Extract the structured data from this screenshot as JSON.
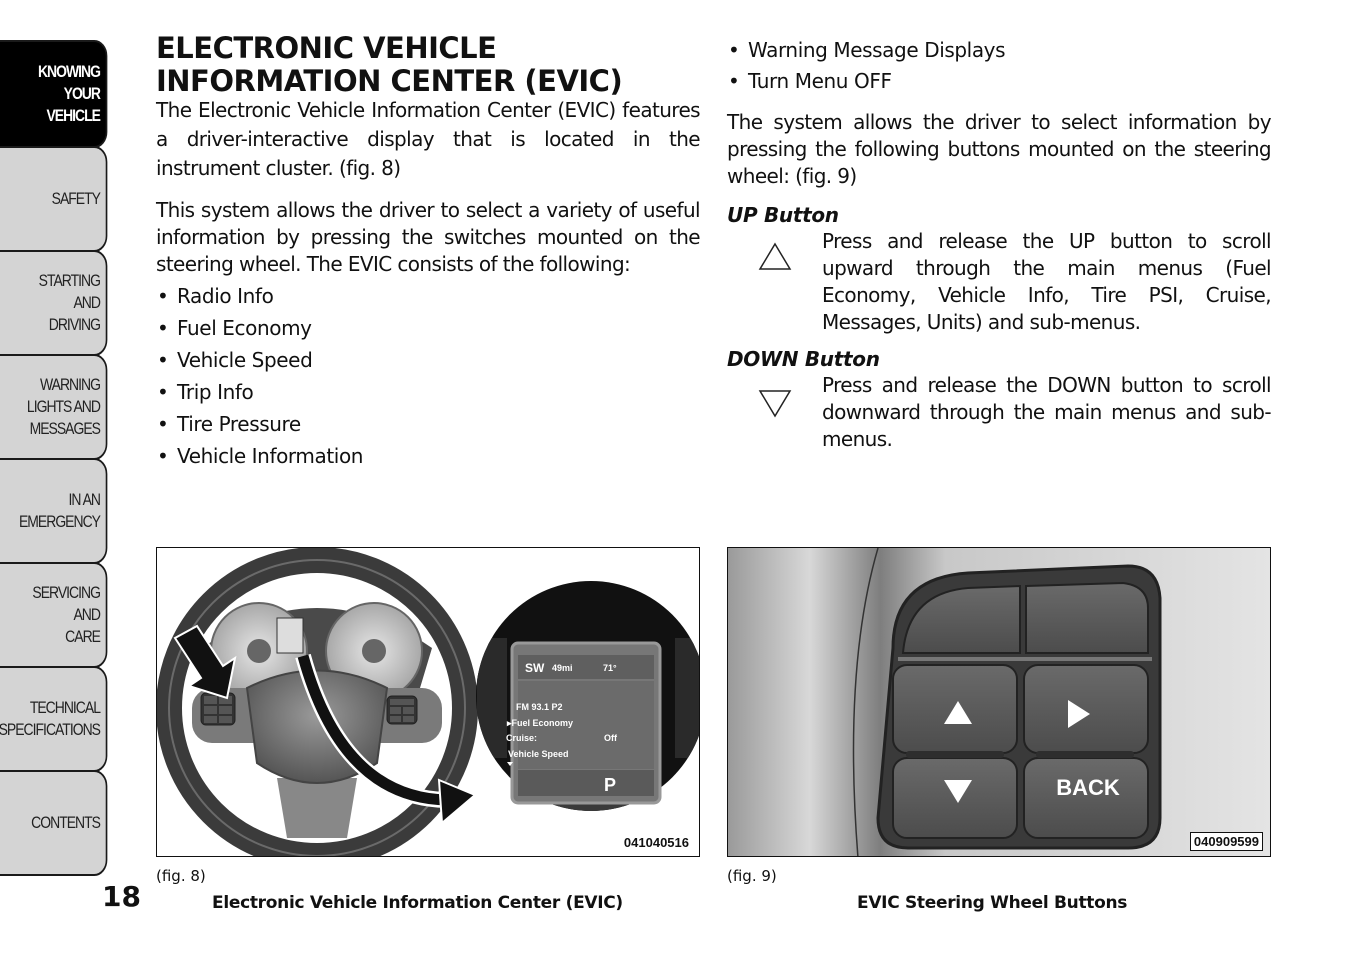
{
  "side_tabs": [
    {
      "label": "KNOWING\nYOUR\nVEHICLE",
      "active": true
    },
    {
      "label": "SAFETY",
      "active": false
    },
    {
      "label": "STARTING\nAND\nDRIVING",
      "active": false
    },
    {
      "label": "WARNING\nLIGHTS AND\nMESSAGES",
      "active": false
    },
    {
      "label": "IN AN\nEMERGENCY",
      "active": false
    },
    {
      "label": "SERVICING\nAND\nCARE",
      "active": false
    },
    {
      "label": "TECHNICAL\nSPECIFICATIONS",
      "active": false
    },
    {
      "label": "CONTENTS",
      "active": false
    }
  ],
  "page_number": "18",
  "left_column": {
    "title_line1": "ELECTRONIC VEHICLE",
    "title_line2": "INFORMATION CENTER (EVIC)",
    "para1": "The Electronic Vehicle Information Center (EVIC) features a driver-interactive display that is located in the instrument cluster. (fig.  8)",
    "para2": "This system allows the driver to select a variety of useful information by pressing the switches mounted on the steering wheel. The EVIC consists of the following:",
    "bullets": [
      "Radio Info",
      "Fuel Economy",
      "Vehicle Speed",
      "Trip Info",
      "Tire Pressure",
      "Vehicle Information"
    ]
  },
  "right_column": {
    "bullets": [
      "Warning Message Displays",
      "Turn Menu OFF"
    ],
    "para1": "The system allows the driver to select information by pressing the following buttons mounted on the steering wheel: (fig.  9)",
    "up_button": {
      "heading": "UP Button",
      "icon": "triangle-up-outline",
      "text": "Press and release the UP button to scroll upward through the main menus (Fuel Economy, Vehicle Info, Tire PSI, Cruise, Messages, Units) and sub-menus."
    },
    "down_button": {
      "heading": "DOWN Button",
      "icon": "triangle-down-outline",
      "text": "Press and release the DOWN button to scroll downward through the main menus and sub-menus."
    }
  },
  "figure8": {
    "label": "(fig. 8)",
    "caption": "Electronic Vehicle Information Center (EVIC)",
    "code": "041040516",
    "display": {
      "compass": "SW",
      "range": "49mi",
      "temperature": "71°",
      "radio": "FM 93.1 P2",
      "selected_item": "▸Fuel Economy",
      "cruise_label": "Cruise:",
      "cruise_value": "Off",
      "speed_item": "Vehicle Speed",
      "gear": "P"
    }
  },
  "figure9": {
    "label": "(fig. 9)",
    "caption": "EVIC Steering Wheel Buttons",
    "code": "040909599",
    "back_label": "BACK"
  }
}
